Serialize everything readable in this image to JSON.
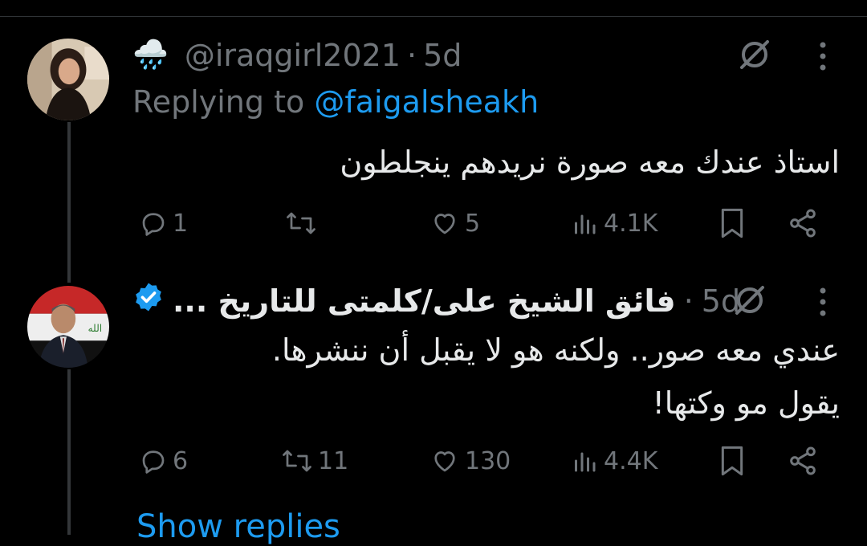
{
  "tweet1": {
    "handle": "@iraqgirl2021",
    "time": "5d",
    "handle_emoji": "🌧️",
    "replying_prefix": "Replying to",
    "replying_to": "@faigalsheakh",
    "text": "استاذ عندك معه صورة نريدهم ينجلطون",
    "replies": "1",
    "retweets": "",
    "likes": "5",
    "views": "4.1K"
  },
  "tweet2": {
    "name": "فائق الشيخ على/كلمتى للتاريخ ...",
    "time": "5d",
    "text_line1": "عندي معه صور.. ولكنه هو لا يقبل أن ننشرها.",
    "text_line2": "يقول مو وكتها!",
    "replies": "6",
    "retweets": "11",
    "likes": "130",
    "views": "4.4K"
  },
  "dot": "·",
  "show_replies": "Show replies",
  "colors": {
    "background": "#000000",
    "text": "#e7e9ea",
    "muted": "#71767b",
    "link": "#1d9bf0",
    "verified": "#1d9bf0",
    "divider": "#2f3336"
  },
  "icons": [
    "rain-cloud-emoji",
    "grok-icon",
    "more-icon",
    "reply-icon",
    "retweet-icon",
    "like-icon",
    "views-icon",
    "bookmark-icon",
    "share-icon",
    "verified-icon"
  ]
}
